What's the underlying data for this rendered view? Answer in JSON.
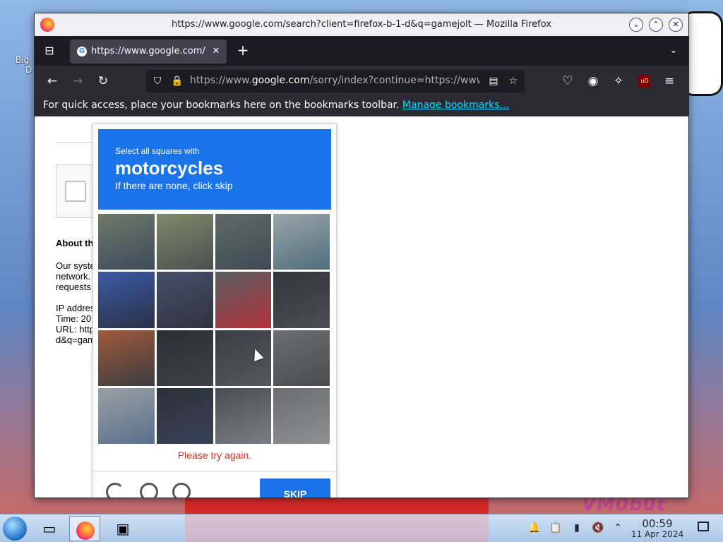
{
  "desktop": {
    "icon_label_line1": "Big",
    "icon_label_line2": "D",
    "watermark": "VM0b0t"
  },
  "window": {
    "title": "https://www.google.com/search?client=firefox-b-1-d&q=gamejolt — Mozilla Firefox",
    "minimize_glyph": "⌄",
    "maximize_glyph": "⌃",
    "close_glyph": "✕"
  },
  "tabs": {
    "active_tab_title": "https://www.google.com/",
    "close_glyph": "✕",
    "new_tab_glyph": "+",
    "list_glyph": "⌄",
    "favicon_letter": "G",
    "view_tabs_glyph": "⊟"
  },
  "navbar": {
    "back_glyph": "←",
    "forward_glyph": "→",
    "reload_glyph": "↻",
    "url_prefix": "https://www.",
    "url_domain": "google.com",
    "url_rest": "/sorry/index?continue=https://www.google.com/search?client",
    "shield_glyph": "⛉",
    "lock_glyph": "🔒",
    "reader_glyph": "▤",
    "star_glyph": "☆",
    "pocket_glyph": "♡",
    "account_glyph": "◉",
    "extensions_glyph": "✧",
    "ublock_label": "uD",
    "menu_glyph": "≡"
  },
  "bookmarks_bar": {
    "text": "For quick access, place your bookmarks here on the bookmarks toolbar.",
    "link": "Manage bookmarks…"
  },
  "page": {
    "about_title": "About th",
    "lines": [
      "Our syste",
      "network.",
      "requests",
      "",
      "IP addres",
      "Time: 20",
      "URL: http",
      "d&q=gam"
    ]
  },
  "captcha": {
    "instruction": "Select all squares with",
    "target": "motorcycles",
    "hint": "If there are none, click skip",
    "error": "Please try again.",
    "skip_label": "SKIP",
    "tiles": 16
  },
  "taskbar": {
    "time": "00:59",
    "date": "11 Apr 2024"
  }
}
